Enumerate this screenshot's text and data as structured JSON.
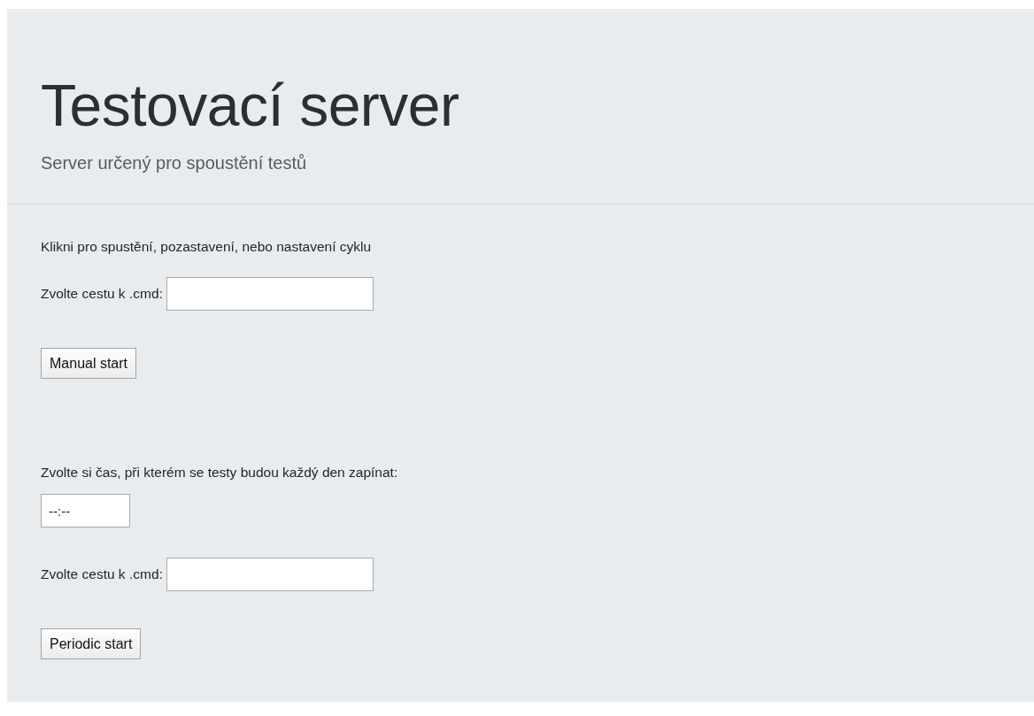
{
  "header": {
    "title": "Testovací server",
    "subtitle": "Server určený pro spoustění testů"
  },
  "items": [
    {
      "kind": "text",
      "text": "Klikni pro spustění, pozastavení, nebo nastavení cyklu"
    },
    {
      "kind": "path-field",
      "label": "Zvolte cestu k .cmd:"
    },
    {
      "kind": "button",
      "label": "Manual start"
    },
    {
      "kind": "text",
      "text": "Zvolte si čas, při kterém se testy budou každý den zapínat:"
    },
    {
      "kind": "time-field",
      "placeholder": "--:--"
    },
    {
      "kind": "path-field",
      "label": "Zvolte cestu k .cmd:"
    },
    {
      "kind": "button",
      "label": "Periodic start"
    }
  ]
}
